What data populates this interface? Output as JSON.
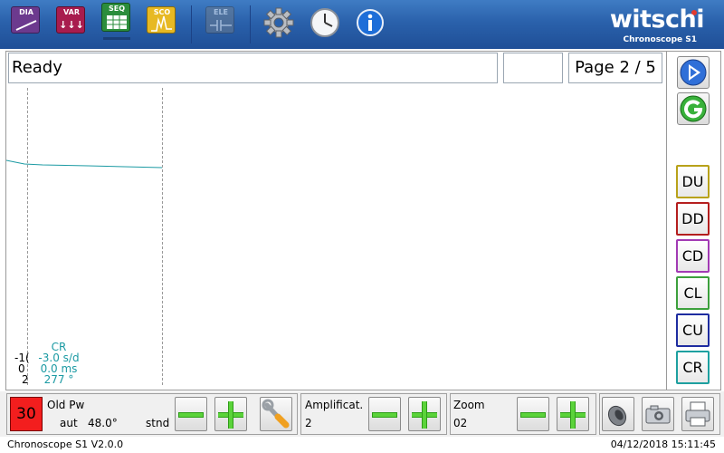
{
  "toolbar": {
    "tools": [
      {
        "tag": "DIA",
        "name": "dia"
      },
      {
        "tag": "VAR",
        "name": "var"
      },
      {
        "tag": "SEQ",
        "name": "seq"
      },
      {
        "tag": "SCO",
        "name": "sco"
      },
      {
        "tag": "ELE",
        "name": "ele"
      }
    ],
    "logo": "witschi",
    "logo_sub": "Chronoscope S1"
  },
  "status": {
    "message": "Ready",
    "page": "Page 2 / 5"
  },
  "readout": {
    "channel": "CR",
    "rate": "-3.0 s/d",
    "beat_error": "0.0 ms",
    "amplitude": "277 °",
    "hidden_col": [
      "-1(",
      "0",
      "2"
    ]
  },
  "side_buttons": {
    "channels": [
      {
        "label": "DU",
        "color": "#b8a21a"
      },
      {
        "label": "DD",
        "color": "#b41e1e"
      },
      {
        "label": "CD",
        "color": "#a23ab4"
      },
      {
        "label": "CL",
        "color": "#3ca03c"
      },
      {
        "label": "CU",
        "color": "#1e2ca0"
      },
      {
        "label": "CR",
        "color": "#1ea0a0"
      }
    ]
  },
  "bottom": {
    "lift_value": "30",
    "mode_label": "Old Pw",
    "mode_sub": "aut",
    "lift_angle": "48.0°",
    "std": "stnd",
    "amplification_label": "Amplificat.",
    "amplification_value": "2",
    "zoom_label": "Zoom",
    "zoom_value": "02"
  },
  "footer": {
    "version": "Chronoscope S1 V2.0.0",
    "datetime": "04/12/2018 15:11:45"
  },
  "colors": {
    "toolbar": "#2a61ab",
    "trace": "#1b9aa3",
    "green": "#5bd33a"
  }
}
